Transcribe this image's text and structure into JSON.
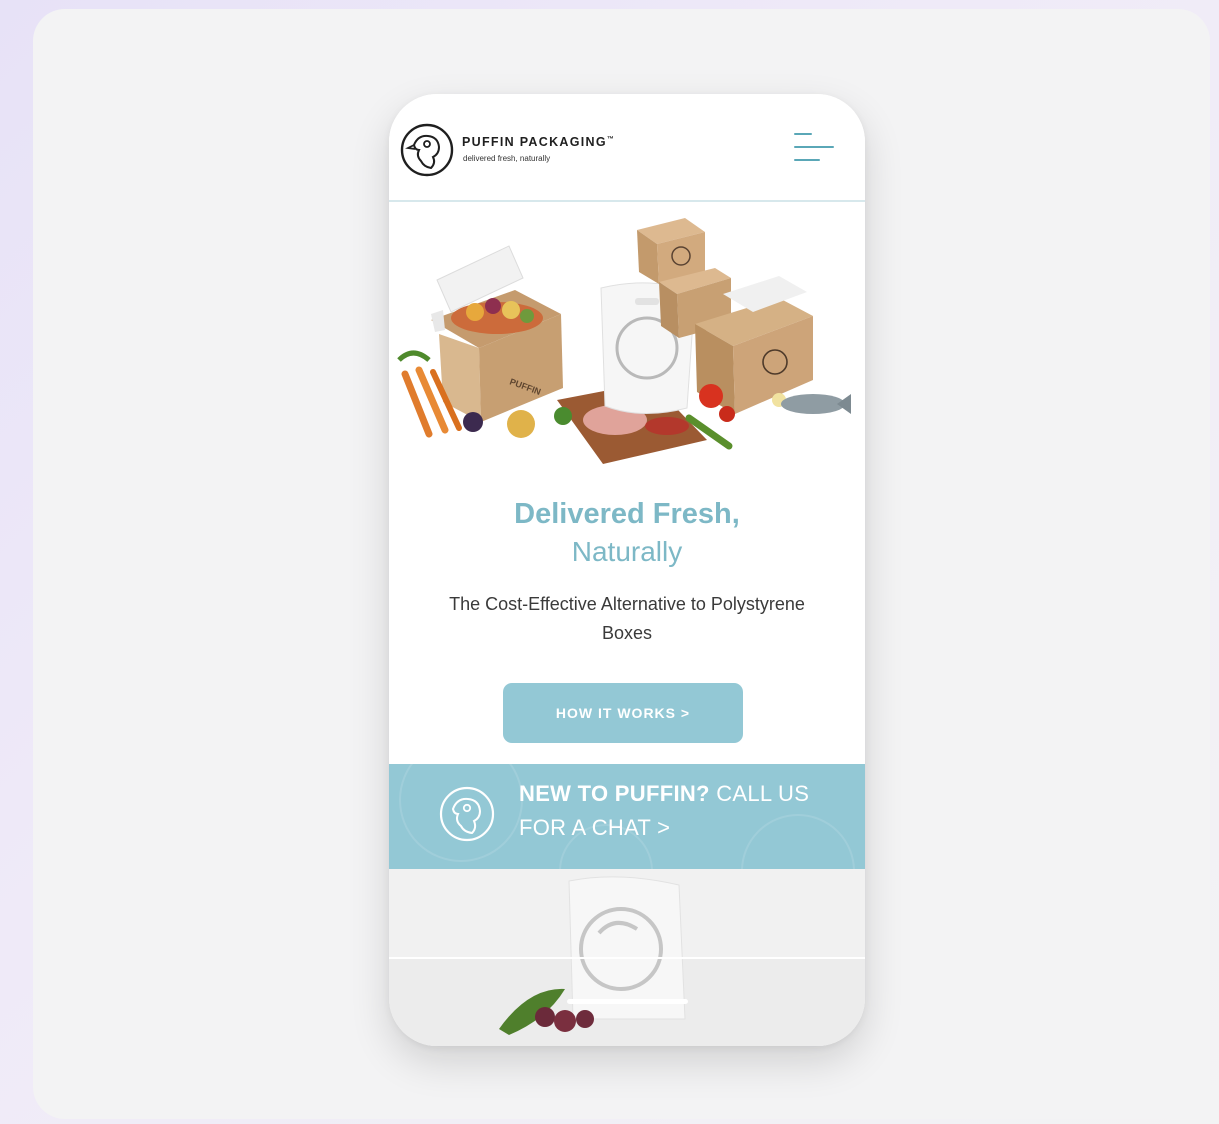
{
  "header": {
    "brand": "PUFFIN PACKAGING",
    "trademark": "™",
    "tagline": "delivered fresh, naturally",
    "menu_icon": "hamburger-menu-icon",
    "logo_icon": "puffin-logo-icon"
  },
  "hero": {
    "box_label": "PUFFIN",
    "headline": "Delivered Fresh,",
    "subheadline": "Naturally",
    "description": "The Cost-Effective Alternative to Polystyrene Boxes",
    "cta_label": "HOW IT WORKS >"
  },
  "banner": {
    "bold_text": "NEW TO PUFFIN?",
    "text": " CALL US FOR A CHAT >",
    "icon": "puffin-logo-icon"
  },
  "colors": {
    "accent": "#93c8d5",
    "heading": "#7db8c6",
    "menu": "#5aa7b7"
  }
}
